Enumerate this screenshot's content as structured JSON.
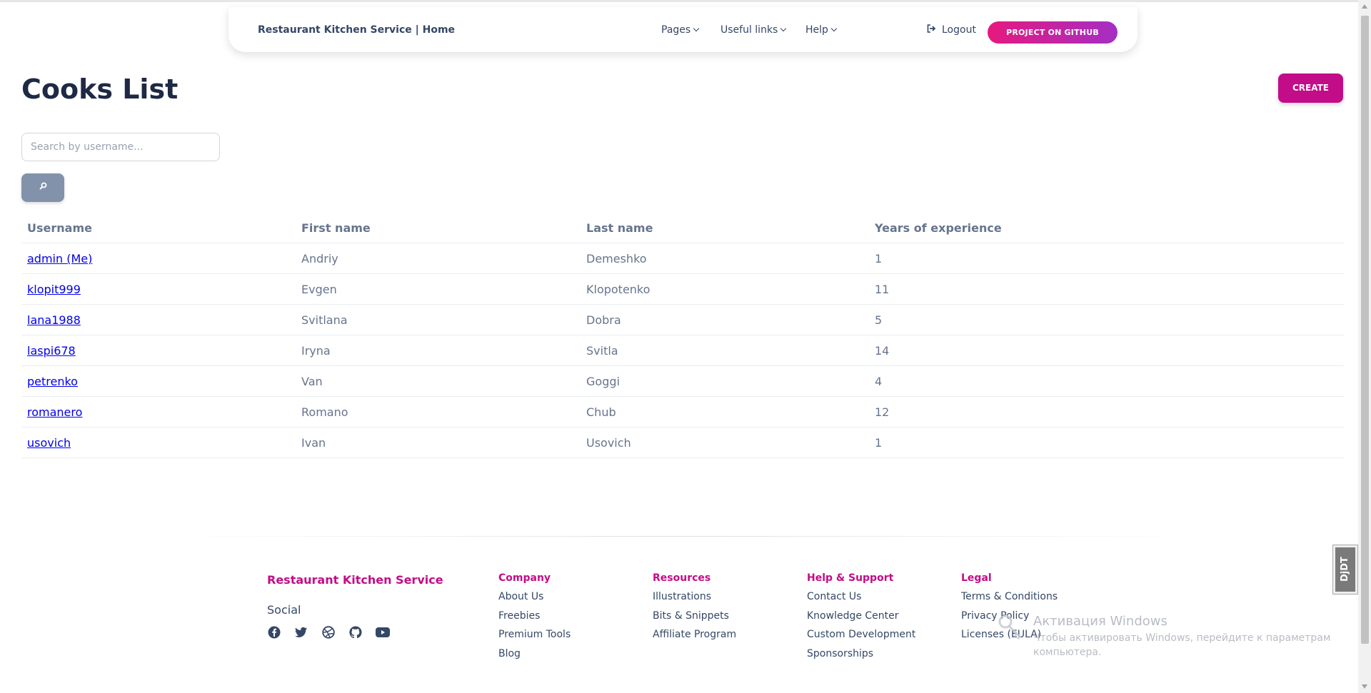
{
  "navbar": {
    "brand": "Restaurant Kitchen Service | Home",
    "items": [
      {
        "label": "Pages"
      },
      {
        "label": "Useful links"
      },
      {
        "label": "Help"
      }
    ],
    "logout_label": "Logout",
    "github_label": "Project on Github"
  },
  "page": {
    "title": "Cooks List",
    "create_label": "CREATE"
  },
  "search": {
    "placeholder": "Search by username...",
    "value": ""
  },
  "table": {
    "headers": [
      "Username",
      "First name",
      "Last name",
      "Years of experience"
    ],
    "rows": [
      {
        "username": "admin (Me)",
        "first": "Andriy",
        "last": "Demeshko",
        "years": "1"
      },
      {
        "username": "klopit999",
        "first": "Evgen",
        "last": "Klopotenko",
        "years": "11"
      },
      {
        "username": "lana1988",
        "first": "Svitlana",
        "last": "Dobra",
        "years": "5"
      },
      {
        "username": "laspi678",
        "first": "Iryna",
        "last": "Svitla",
        "years": "14"
      },
      {
        "username": "petrenko",
        "first": "Van",
        "last": "Goggi",
        "years": "4"
      },
      {
        "username": "romanero",
        "first": "Romano",
        "last": "Chub",
        "years": "12"
      },
      {
        "username": "usovich",
        "first": "Ivan",
        "last": "Usovich",
        "years": "1"
      }
    ]
  },
  "footer": {
    "brand": "Restaurant Kitchen Service",
    "social_label": "Social",
    "social_icons": [
      "facebook-icon",
      "twitter-icon",
      "dribbble-icon",
      "github-icon",
      "youtube-icon"
    ],
    "columns": [
      {
        "title": "Company",
        "links": [
          "About Us",
          "Freebies",
          "Premium Tools",
          "Blog"
        ]
      },
      {
        "title": "Resources",
        "links": [
          "Illustrations",
          "Bits & Snippets",
          "Affiliate Program"
        ]
      },
      {
        "title": "Help & Support",
        "links": [
          "Contact Us",
          "Knowledge Center",
          "Custom Development",
          "Sponsorships"
        ]
      },
      {
        "title": "Legal",
        "links": [
          "Terms & Conditions",
          "Privacy Policy",
          "Licenses (EULA)"
        ]
      }
    ]
  },
  "watermark": {
    "title": "Активация Windows",
    "subtitle": "Чтобы активировать Windows, перейдите к параметрам компьютера."
  },
  "debug_toolbar": {
    "label": "DjDT"
  },
  "colors": {
    "accent": "#c30c87",
    "text": "#344767",
    "muted": "#67748e",
    "search_button": "#8392ab"
  }
}
